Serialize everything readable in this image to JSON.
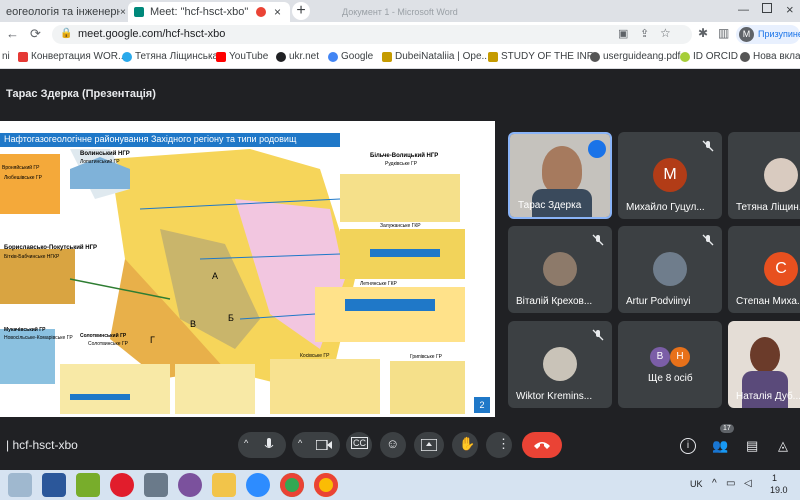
{
  "browser": {
    "tabs": [
      {
        "title": "еогеологія та інженерна геол"
      },
      {
        "title": "Meet: \"hcf-hsct-xbo\""
      },
      {
        "title": "Документ 1 - Microsoft Word"
      }
    ],
    "url": "meet.google.com/hcf-hsct-xbo",
    "profile_initial": "M",
    "profile_status": "Призупинено",
    "bookmarks": [
      {
        "label": "ni",
        "color": "#4285f4"
      },
      {
        "label": "Конвертация WOR...",
        "color": "#e53935"
      },
      {
        "label": "Тетяна Ліщинська",
        "color": "#29a9eb"
      },
      {
        "label": "YouTube",
        "color": "#ff0000"
      },
      {
        "label": "ukr.net",
        "color": "#202124"
      },
      {
        "label": "Google",
        "color": "#4285f4"
      },
      {
        "label": "DubeiNataliia | Ope...",
        "color": "#c59b00"
      },
      {
        "label": "STUDY OF THE INF...",
        "color": "#c59b00"
      },
      {
        "label": "userguideang.pdf",
        "color": "#555555"
      },
      {
        "label": "ID ORCID",
        "color": "#a6ce39"
      },
      {
        "label": "Нова вклад",
        "color": "#555555"
      }
    ]
  },
  "meet": {
    "presenter_title": "Тарас Здерка (Презентація)",
    "slide": {
      "title": "Нафтогазогеологічне районування Західного регіону та типи родовищ",
      "page_number": "2",
      "map_labels": [
        "Волинський НГР",
        "Лопатинський ГР",
        "Вроняйський ГР",
        "Любешівське ГР",
        "Бориславсько-Покутський НГР",
        "Бітків-Бабчинське НГКР",
        "Мукачівський ГР",
        "Новосільське-Комарівське ГР",
        "Солотвинський ГР",
        "Солотвинське ГР",
        "Більче-Волицький НГР",
        "Рудківське ГР",
        "Залужанське ГКР",
        "Летнянське ГКР",
        "Косівське ГР",
        "Грипівське ГР",
        "А",
        "Б",
        "В",
        "Г"
      ]
    },
    "participants": [
      {
        "name": "Тарас Здерка",
        "type": "video",
        "speaking": true
      },
      {
        "name": "Михайло Гуцул...",
        "type": "initial",
        "initial": "М",
        "color": "#b23c17",
        "muted": true
      },
      {
        "name": "Тетяна Ліщин...",
        "type": "photo",
        "muted": true
      },
      {
        "name": "Віталій Крехов...",
        "type": "photo",
        "muted": true
      },
      {
        "name": "Artur Podviinyi",
        "type": "photo",
        "muted": true
      },
      {
        "name": "Степан Миха...",
        "type": "initial",
        "initial": "С",
        "color": "#e8501f",
        "muted": true
      },
      {
        "name": "Wiktor Kremins...",
        "type": "photo",
        "muted": true
      },
      {
        "name": "Ще 8 осіб",
        "type": "group",
        "initials": [
          "В",
          "Н"
        ]
      },
      {
        "name": "Наталія Дуб...",
        "type": "video"
      }
    ],
    "meeting_code": "hcf-hsct-xbo",
    "people_count": "17"
  },
  "taskbar": {
    "lang": "UK",
    "time": "1",
    "date": "19.0",
    "icons": [
      "explorer",
      "word",
      "utorrent",
      "opera",
      "tools",
      "viber",
      "folder",
      "zoom",
      "chrome-profile",
      "chrome"
    ]
  }
}
